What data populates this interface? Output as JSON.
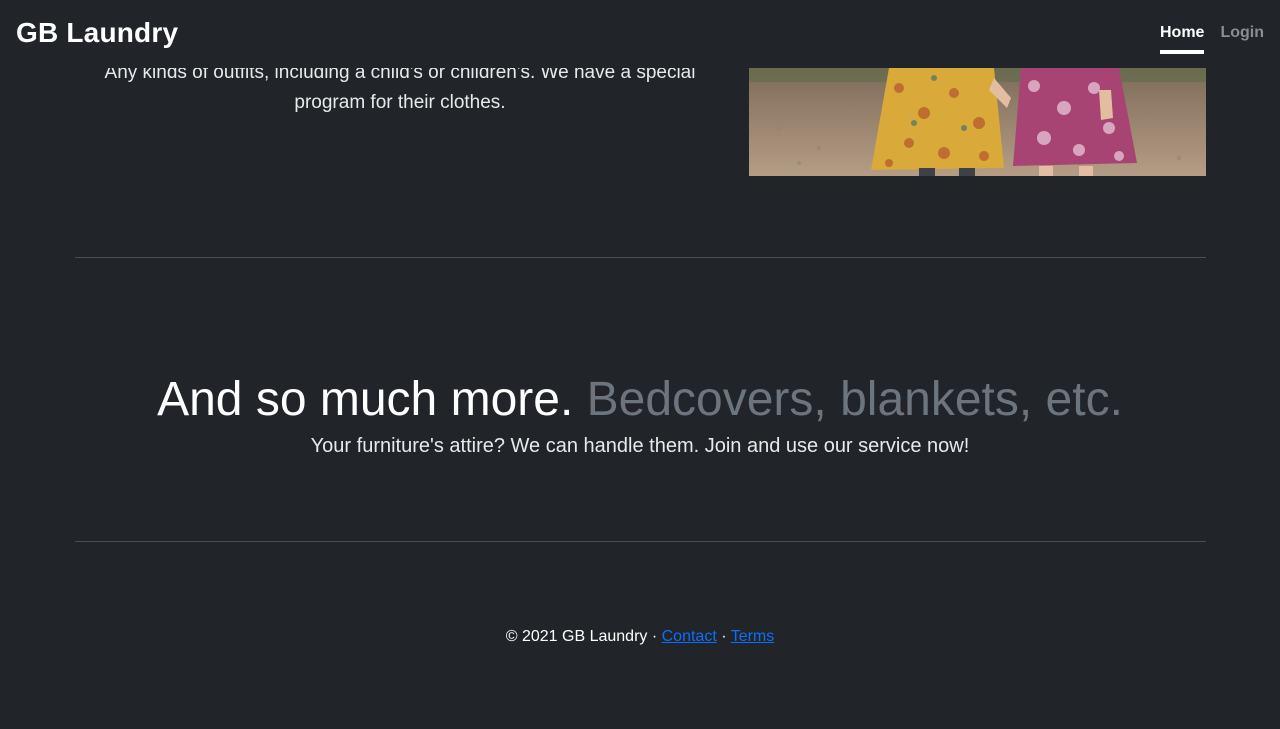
{
  "header": {
    "brand": "GB Laundry",
    "nav": [
      {
        "label": "Home",
        "active": true
      },
      {
        "label": "Login",
        "active": false
      }
    ]
  },
  "feature": {
    "text": "Any kinds of outfits, including a child's or children's. We have a special program for their clothes."
  },
  "more": {
    "heading_main": "And so much more.",
    "heading_muted": "Bedcovers, blankets, etc.",
    "lead": "Your furniture's attire? We can handle them. Join and use our service now!"
  },
  "footer": {
    "copyright": "© 2021 GB Laundry",
    "separator": "·",
    "contact_label": "Contact",
    "terms_label": "Terms"
  },
  "colors": {
    "background": "#212428",
    "muted_heading": "#6c757d",
    "link": "#0d6efd"
  }
}
